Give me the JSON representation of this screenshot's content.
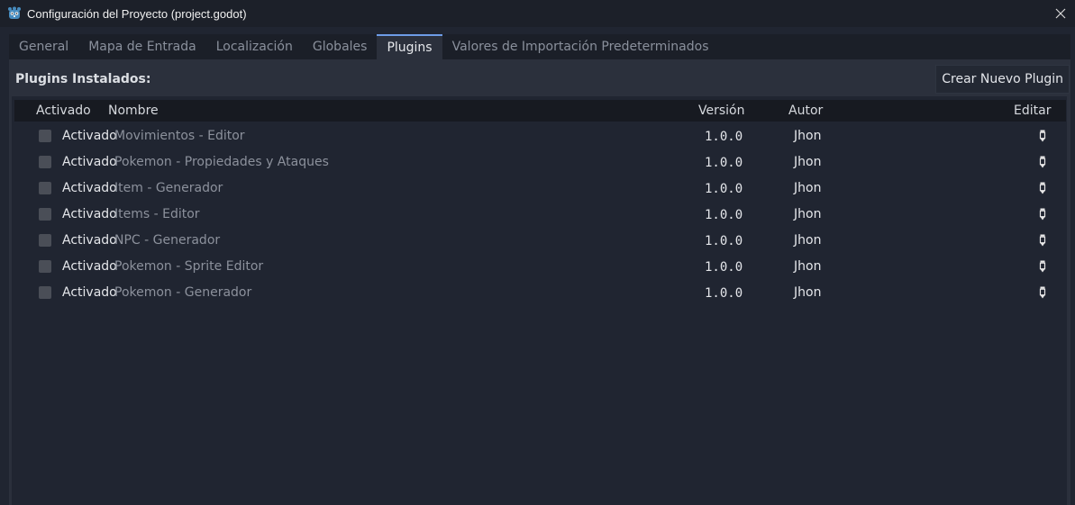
{
  "window": {
    "title": "Configuración del Proyecto (project.godot)",
    "app_icon": "godot-icon",
    "close_icon": "close-icon"
  },
  "tabs": [
    {
      "label": "General",
      "active": false
    },
    {
      "label": "Mapa de Entrada",
      "active": false
    },
    {
      "label": "Localización",
      "active": false
    },
    {
      "label": "Globales",
      "active": false
    },
    {
      "label": "Plugins",
      "active": true
    },
    {
      "label": "Valores de Importación Predeterminados",
      "active": false
    }
  ],
  "plugins_panel": {
    "title": "Plugins Instalados:",
    "create_button": "Crear Nuevo Plugin",
    "columns": {
      "enabled": "Activado",
      "name": "Nombre",
      "version": "Versión",
      "author": "Autor",
      "edit": "Editar"
    },
    "rows": [
      {
        "enabled_label": "Activado",
        "checked": false,
        "name": "Movimientos - Editor",
        "version": "1.0.0",
        "author": "Jhon"
      },
      {
        "enabled_label": "Activado",
        "checked": false,
        "name": "Pokemon - Propiedades y Ataques",
        "version": "1.0.0",
        "author": "Jhon"
      },
      {
        "enabled_label": "Activado",
        "checked": false,
        "name": "Item - Generador",
        "version": "1.0.0",
        "author": "Jhon"
      },
      {
        "enabled_label": "Activado",
        "checked": false,
        "name": "Items - Editor",
        "version": "1.0.0",
        "author": "Jhon"
      },
      {
        "enabled_label": "Activado",
        "checked": false,
        "name": "NPC - Generador",
        "version": "1.0.0",
        "author": "Jhon"
      },
      {
        "enabled_label": "Activado",
        "checked": false,
        "name": "Pokemon - Sprite Editor",
        "version": "1.0.0",
        "author": "Jhon"
      },
      {
        "enabled_label": "Activado",
        "checked": false,
        "name": "Pokemon - Generador",
        "version": "1.0.0",
        "author": "Jhon"
      }
    ],
    "edit_icon": "pencil-icon"
  },
  "colors": {
    "accent": "#6d9ce6",
    "background": "#202531",
    "panel": "#2b303c"
  }
}
